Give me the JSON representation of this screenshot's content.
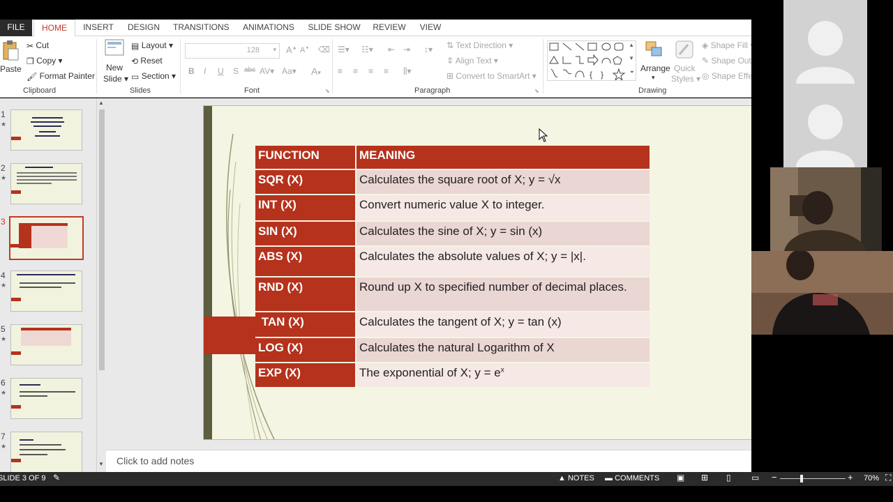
{
  "ribbon": {
    "tabs": [
      "FILE",
      "HOME",
      "INSERT",
      "DESIGN",
      "TRANSITIONS",
      "ANIMATIONS",
      "SLIDE SHOW",
      "REVIEW",
      "VIEW"
    ],
    "clipboard": {
      "paste": "Paste",
      "cut": "Cut",
      "copy": "Copy",
      "format_painter": "Format Painter",
      "label": "Clipboard"
    },
    "slides": {
      "new_slide_1": "New",
      "new_slide_2": "Slide",
      "layout": "Layout",
      "reset": "Reset",
      "section": "Section",
      "label": "Slides"
    },
    "font": {
      "size": "128",
      "label": "Font",
      "bold": "B",
      "italic": "I",
      "underline": "U",
      "shadow": "S",
      "strike": "abc",
      "spacing": "AV",
      "case": "Aa",
      "color": "A"
    },
    "paragraph": {
      "text_direction": "Text Direction",
      "align_text": "Align Text",
      "convert_smartart": "Convert to SmartArt",
      "label": "Paragraph"
    },
    "drawing": {
      "arrange": "Arrange",
      "quick_styles_1": "Quick",
      "quick_styles_2": "Styles",
      "shape_fill": "Shape Fill",
      "shape_outline": "Shape Outl",
      "shape_effects": "Shape Effe",
      "label": "Drawing"
    }
  },
  "thumbnails": {
    "numbers": [
      "1",
      "2",
      "3",
      "4",
      "5",
      "6",
      "7"
    ],
    "selected_index": 3
  },
  "slide": {
    "table": {
      "headers": [
        "FUNCTION",
        "MEANING"
      ],
      "rows": [
        [
          "SQR (X)",
          "Calculates the square root of X; y = √x"
        ],
        [
          "INT (X)",
          "Convert numeric value X to integer."
        ],
        [
          "SIN (X)",
          "Calculates the sine of X; y = sin (x)"
        ],
        [
          "ABS (X)",
          "Calculates the absolute values of X; y = |x|."
        ],
        [
          "RND (X)",
          "Round up X to specified number of decimal places."
        ],
        [
          " TAN (X)",
          "Calculates the tangent of X; y = tan (x)"
        ],
        [
          "LOG (X)",
          "Calculates the natural Logarithm of X"
        ],
        [
          "EXP (X)",
          "The exponential of X; y = e"
        ]
      ],
      "exp_superscript": "x"
    }
  },
  "notes": {
    "placeholder": "Click to add notes"
  },
  "status": {
    "slide_counter": "SLIDE 3 OF 9",
    "notes": "NOTES",
    "comments": "COMMENTS",
    "zoom": "70%"
  },
  "colors": {
    "accent": "#b5321c",
    "slide_bg": "#f5f5e3",
    "home_tab": "#c0392b"
  }
}
